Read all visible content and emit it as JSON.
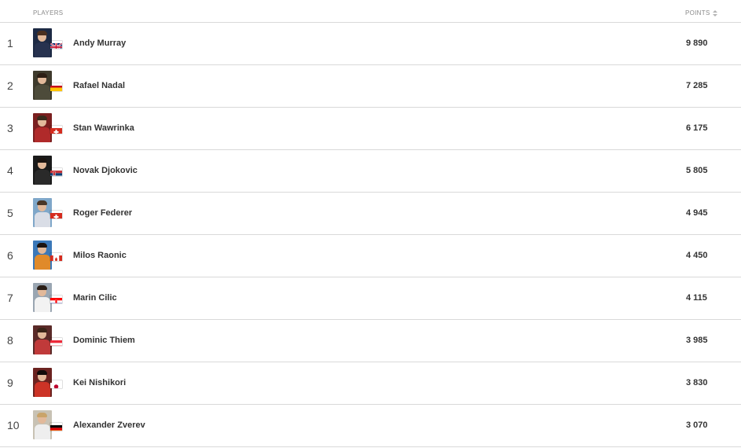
{
  "header": {
    "players_label": "PLAYERS",
    "points_label": "POINTS"
  },
  "rows": [
    {
      "rank": "1",
      "name": "Andy Murray",
      "points": "9 890",
      "flag": "gb-flag-icon",
      "photo_bg": "#1d2a44",
      "hair": "#4a3020",
      "shirt": "#27324f"
    },
    {
      "rank": "2",
      "name": "Rafael Nadal",
      "points": "7 285",
      "flag": "es-flag-icon",
      "photo_bg": "#3e3a2c",
      "hair": "#2c1e14",
      "shirt": "#4d4b3a"
    },
    {
      "rank": "3",
      "name": "Stan Wawrinka",
      "points": "6 175",
      "flag": "ch-flag-icon",
      "photo_bg": "#7a1f1f",
      "hair": "#3a2a1c",
      "shirt": "#b02a2a"
    },
    {
      "rank": "4",
      "name": "Novak Djokovic",
      "points": "5 805",
      "flag": "rs-flag-icon",
      "photo_bg": "#1a1a1a",
      "hair": "#1b1410",
      "shirt": "#2a2a2a"
    },
    {
      "rank": "5",
      "name": "Roger Federer",
      "points": "4 945",
      "flag": "ch-flag-icon",
      "photo_bg": "#7fa7c9",
      "hair": "#4a3626",
      "shirt": "#d9dde6"
    },
    {
      "rank": "6",
      "name": "Milos Raonic",
      "points": "4 450",
      "flag": "ca-flag-icon",
      "photo_bg": "#3b78b8",
      "hair": "#1d1410",
      "shirt": "#e08a2a"
    },
    {
      "rank": "7",
      "name": "Marin Cilic",
      "points": "4 115",
      "flag": "hr-flag-icon",
      "photo_bg": "#9aa6b2",
      "hair": "#2a1e16",
      "shirt": "#f2f2f2"
    },
    {
      "rank": "8",
      "name": "Dominic Thiem",
      "points": "3 985",
      "flag": "at-flag-icon",
      "photo_bg": "#5a2a28",
      "hair": "#3a2418",
      "shirt": "#c03a3a"
    },
    {
      "rank": "9",
      "name": "Kei Nishikori",
      "points": "3 830",
      "flag": "jp-flag-icon",
      "photo_bg": "#6b2320",
      "hair": "#120c0a",
      "shirt": "#cc3326"
    },
    {
      "rank": "10",
      "name": "Alexander Zverev",
      "points": "3 070",
      "flag": "de-flag-icon",
      "photo_bg": "#c8c2b4",
      "hair": "#c9a46a",
      "shirt": "#eeeeee"
    }
  ]
}
